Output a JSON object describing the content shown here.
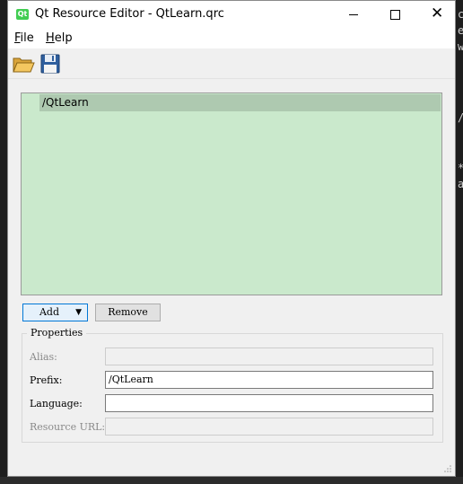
{
  "window": {
    "app_icon_text": "Qt",
    "title": "Qt Resource Editor - QtLearn.qrc",
    "controls": {
      "minimize_icon": "minimize-icon",
      "maximize_icon": "maximize-icon",
      "close_glyph": "✕"
    }
  },
  "menu": {
    "file": {
      "mnemonic": "F",
      "rest": "ile"
    },
    "help": {
      "mnemonic": "H",
      "rest": "elp"
    }
  },
  "toolbar": {
    "open_icon": "folder-open-icon",
    "save_icon": "floppy-save-icon"
  },
  "tree": {
    "items": [
      {
        "label": "/QtLearn"
      }
    ],
    "background": "#cae9cc",
    "selected_background": "#aec9b0"
  },
  "buttons": {
    "add_label": "Add",
    "add_arrow": "▼",
    "remove_label": "Remove"
  },
  "properties": {
    "title": "Properties",
    "alias": {
      "label": "Alias:",
      "value": ""
    },
    "prefix": {
      "label": "Prefix:",
      "value": "/QtLearn"
    },
    "language": {
      "label": "Language:",
      "value": ""
    },
    "resource_url": {
      "label": "Resource URL:",
      "value": ""
    }
  },
  "background_editor": {
    "visible_chars": [
      "c",
      "e",
      "w",
      "/",
      "*",
      "a"
    ]
  },
  "colors": {
    "accent": "#0078d7",
    "qt_green": "#41cd52"
  }
}
